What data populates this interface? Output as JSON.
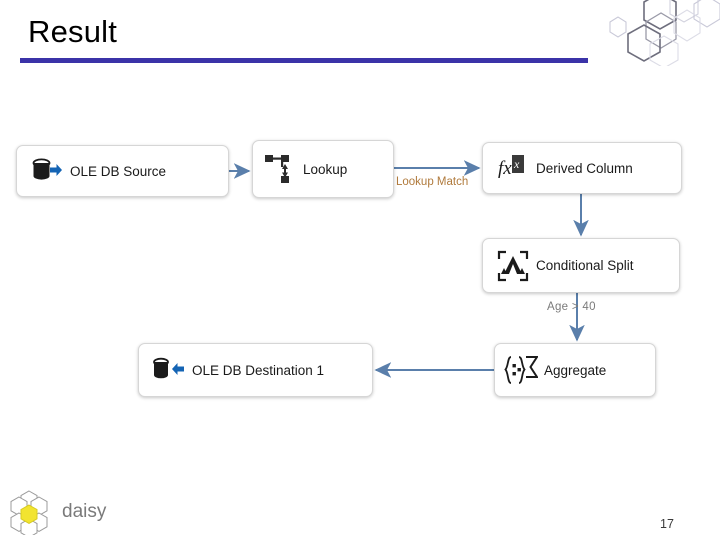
{
  "slide": {
    "title": "Result",
    "page_number": "17",
    "accent_rule_color": "#3b33a8",
    "background_color": "#ffffff"
  },
  "brand": {
    "name": "daisy",
    "petal_color": "#ffffff",
    "center_color": "#f2e430",
    "text_color": "#7a7a7a"
  },
  "diagram": {
    "type": "data-flow",
    "connector_color": "#5a7fab",
    "nodes": [
      {
        "id": "source",
        "label": "OLE DB Source",
        "icon": "database-export-icon"
      },
      {
        "id": "lookup",
        "label": "Lookup",
        "icon": "lookup-icon"
      },
      {
        "id": "derived",
        "label": "Derived Column",
        "icon": "fx-icon"
      },
      {
        "id": "split",
        "label": "Conditional Split",
        "icon": "conditional-split-icon"
      },
      {
        "id": "aggregate",
        "label": "Aggregate",
        "icon": "aggregate-sigma-icon"
      },
      {
        "id": "destination",
        "label": "OLE DB Destination 1",
        "icon": "database-import-icon"
      }
    ],
    "edges": [
      {
        "from": "source",
        "to": "lookup",
        "label": ""
      },
      {
        "from": "lookup",
        "to": "derived",
        "label": "Lookup Match",
        "label_color": "#b07a3c"
      },
      {
        "from": "derived",
        "to": "split",
        "label": ""
      },
      {
        "from": "split",
        "to": "aggregate",
        "label": "Age > 40",
        "label_color": "#7b7b7b"
      },
      {
        "from": "aggregate",
        "to": "destination",
        "label": ""
      }
    ]
  }
}
